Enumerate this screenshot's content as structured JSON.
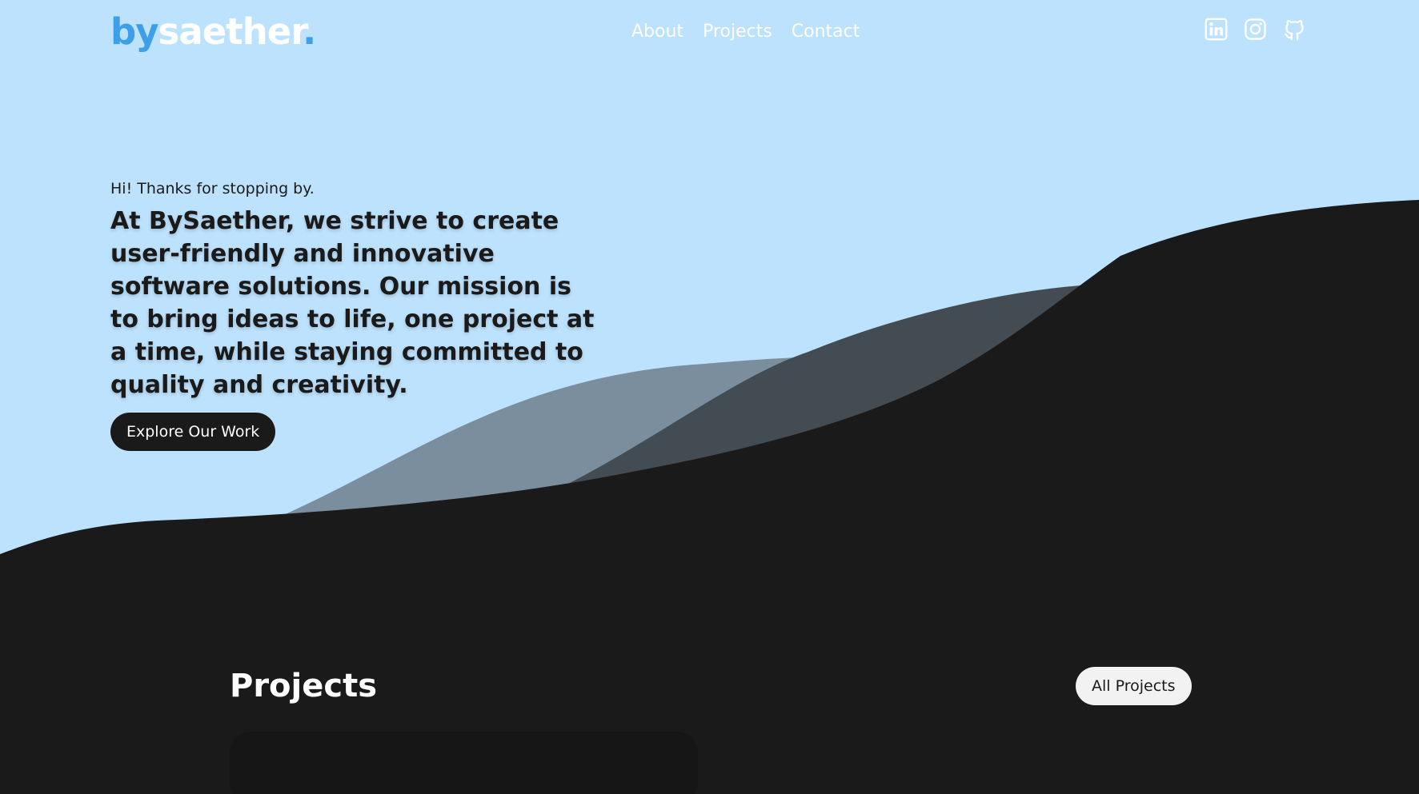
{
  "header": {
    "logo": {
      "prefix": "by",
      "name": "saether",
      "suffix": "."
    },
    "nav": [
      {
        "label": "About"
      },
      {
        "label": "Projects"
      },
      {
        "label": "Contact"
      }
    ],
    "social": [
      {
        "icon": "linkedin-icon"
      },
      {
        "icon": "instagram-icon"
      },
      {
        "icon": "github-icon"
      }
    ]
  },
  "hero": {
    "greeting": "Hi! Thanks for stopping by.",
    "mission": "At BySaether, we strive to create user-friendly and innovative software solutions. Our mission is to bring ideas to life, one project at a time, while staying committed to quality and creativity.",
    "cta_label": "Explore Our Work"
  },
  "projects": {
    "title": "Projects",
    "all_label": "All Projects"
  },
  "colors": {
    "sky": "#bde2fd",
    "accent": "#3d9fe8",
    "dark": "#1a1a1a",
    "wave_mid": "#7a8e9e",
    "wave_dark": "#434c53"
  }
}
